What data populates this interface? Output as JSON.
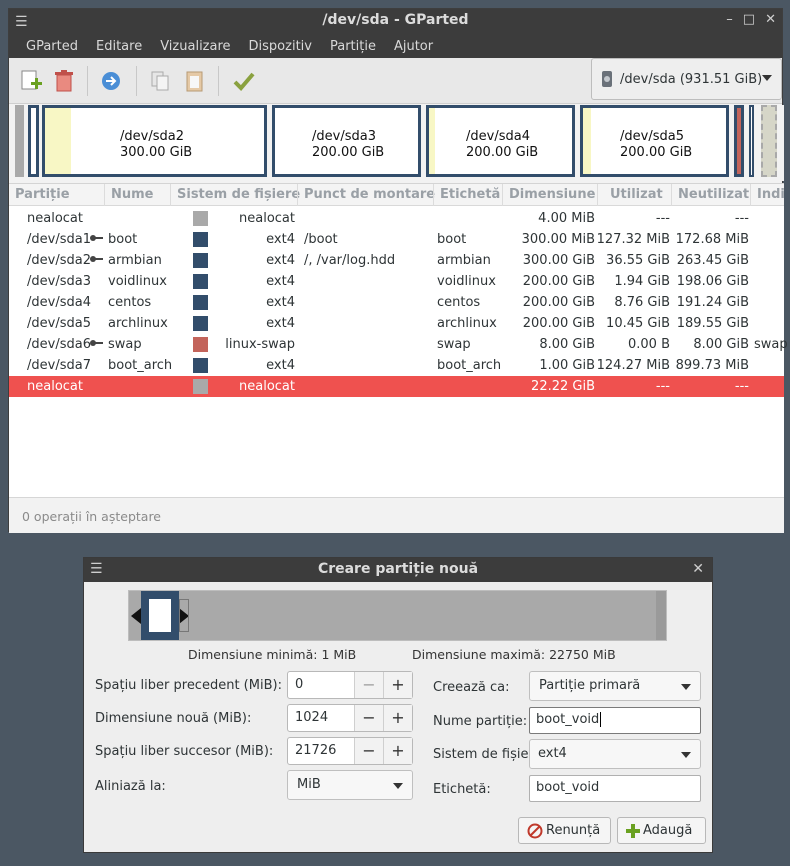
{
  "window": {
    "title": "/dev/sda - GParted",
    "menu": [
      "GParted",
      "Editare",
      "Vizualizare",
      "Dispozitiv",
      "Partiție",
      "Ajutor"
    ],
    "device_selector": "/dev/sda (931.51 GiB)"
  },
  "diskmap": [
    {
      "name": "/dev/sda2",
      "size": "300.00 GiB"
    },
    {
      "name": "/dev/sda3",
      "size": "200.00 GiB"
    },
    {
      "name": "/dev/sda4",
      "size": "200.00 GiB"
    },
    {
      "name": "/dev/sda5",
      "size": "200.00 GiB"
    }
  ],
  "table": {
    "headers": [
      "Partiție",
      "Nume",
      "Sistem de fișiere",
      "Punct de montare",
      "Etichetă",
      "Dimensiune",
      "Utilizat",
      "Neutilizat",
      "Indi"
    ],
    "rows": [
      {
        "partition": "nealocat",
        "name": "",
        "fs": "nealocat",
        "fs_color": "#a9a9a9",
        "mount": "",
        "label": "",
        "size": "4.00 MiB",
        "used": "---",
        "unused": "---",
        "flags": "",
        "key": false
      },
      {
        "partition": "/dev/sda1",
        "name": "boot",
        "fs": "ext4",
        "fs_color": "#324d6b",
        "mount": "/boot",
        "label": "boot",
        "size": "300.00 MiB",
        "used": "127.32 MiB",
        "unused": "172.68 MiB",
        "flags": "",
        "key": true
      },
      {
        "partition": "/dev/sda2",
        "name": "armbian",
        "fs": "ext4",
        "fs_color": "#324d6b",
        "mount": "/, /var/log.hdd",
        "label": "armbian",
        "size": "300.00 GiB",
        "used": "36.55 GiB",
        "unused": "263.45 GiB",
        "flags": "",
        "key": true
      },
      {
        "partition": "/dev/sda3",
        "name": "voidlinux",
        "fs": "ext4",
        "fs_color": "#324d6b",
        "mount": "",
        "label": "voidlinux",
        "size": "200.00 GiB",
        "used": "1.94 GiB",
        "unused": "198.06 GiB",
        "flags": "",
        "key": false
      },
      {
        "partition": "/dev/sda4",
        "name": "centos",
        "fs": "ext4",
        "fs_color": "#324d6b",
        "mount": "",
        "label": "centos",
        "size": "200.00 GiB",
        "used": "8.76 GiB",
        "unused": "191.24 GiB",
        "flags": "",
        "key": false
      },
      {
        "partition": "/dev/sda5",
        "name": "archlinux",
        "fs": "ext4",
        "fs_color": "#324d6b",
        "mount": "",
        "label": "archlinux",
        "size": "200.00 GiB",
        "used": "10.45 GiB",
        "unused": "189.55 GiB",
        "flags": "",
        "key": false
      },
      {
        "partition": "/dev/sda6",
        "name": "swap",
        "fs": "linux-swap",
        "fs_color": "#c3645b",
        "mount": "",
        "label": "swap",
        "size": "8.00 GiB",
        "used": "0.00 B",
        "unused": "8.00 GiB",
        "flags": "swap",
        "key": true
      },
      {
        "partition": "/dev/sda7",
        "name": "boot_arch",
        "fs": "ext4",
        "fs_color": "#324d6b",
        "mount": "",
        "label": "boot_arch",
        "size": "1.00 GiB",
        "used": "124.27 MiB",
        "unused": "899.73 MiB",
        "flags": "",
        "key": false
      },
      {
        "partition": "nealocat",
        "name": "",
        "fs": "nealocat",
        "fs_color": "#a9a9a9",
        "mount": "",
        "label": "",
        "size": "22.22 GiB",
        "used": "---",
        "unused": "---",
        "flags": "",
        "key": false,
        "selected": true
      }
    ]
  },
  "status": "0 operații în așteptare",
  "dialog": {
    "title": "Creare partiție nouă",
    "min_size": "Dimensiune minimă: 1 MiB",
    "max_size": "Dimensiune maximă: 22750 MiB",
    "free_before_label": "Spațiu liber precedent (MiB):",
    "free_before_value": "0",
    "new_size_label": "Dimensiune nouă (MiB):",
    "new_size_value": "1024",
    "free_after_label": "Spațiu liber succesor (MiB):",
    "free_after_value": "21726",
    "align_label": "Aliniază la:",
    "align_value": "MiB",
    "create_as_label": "Creează ca:",
    "create_as_value": "Partiție primară",
    "partition_name_label": "Nume partiție:",
    "partition_name_value": "boot_void",
    "filesystem_label": "Sistem de fișiere:",
    "filesystem_value": "ext4",
    "fs_label_label": "Etichetă:",
    "fs_label_value": "boot_void",
    "cancel_label": "Renunță",
    "add_label": "Adaugă"
  }
}
